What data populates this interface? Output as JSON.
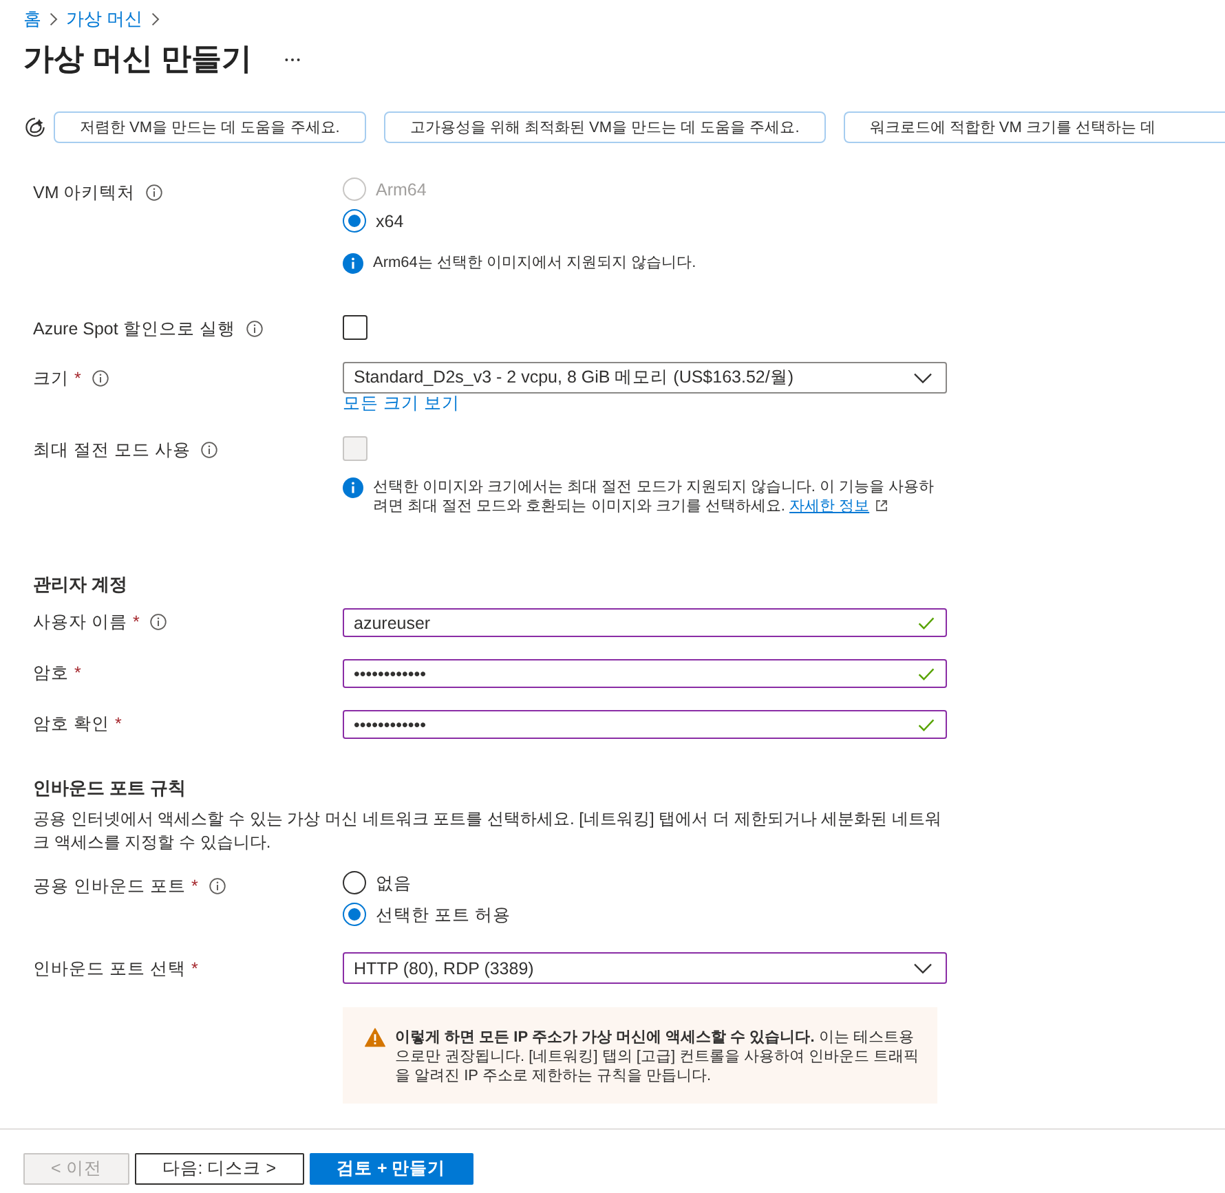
{
  "breadcrumb": [
    {
      "label": "홈"
    },
    {
      "label": "가상 머신"
    }
  ],
  "title": "가상 머신 만들기",
  "suggestions": [
    {
      "label": "저렴한 VM을 만드는 데 도움을 주세요."
    },
    {
      "label": "고가용성을 위해 최적화된 VM을 만드는 데 도움을 주세요."
    },
    {
      "label": "워크로드에 적합한 VM 크기를 선택하는 데"
    }
  ],
  "sections": [
    {
      "fields": [
        {
          "kind": "radio",
          "label": "VM 아키텍처",
          "info": true,
          "options": [
            {
              "label": "Arm64",
              "selected": false,
              "disabled": true
            },
            {
              "label": "x64",
              "selected": true,
              "disabled": false
            }
          ],
          "note": {
            "text": "Arm64는 선택한 이미지에서 지원되지 않습니다."
          }
        },
        {
          "kind": "checkbox",
          "label": "Azure Spot 할인으로 실행",
          "info": true,
          "checked": false,
          "disabled": false
        },
        {
          "kind": "dropdown",
          "label": "크기",
          "required_mark": "*",
          "info": true,
          "value": "Standard_D2s_v3 - 2 vcpu, 8 GiB 메모리 (US$163.52/월)",
          "edited": false,
          "link": "모든 크기 보기"
        },
        {
          "kind": "checkbox",
          "label": "최대 절전 모드 사용",
          "info": true,
          "checked": false,
          "disabled": true,
          "note": {
            "text": "선택한 이미지와 크기에서는 최대 절전 모드가 지원되지 않습니다. 이 기능을 사용하려면 최대 절전 모드와 호환되는 이미지와 크기를 선택하세요.",
            "link": "자세한 정보"
          }
        }
      ]
    },
    {
      "heading": "관리자 계정",
      "fields": [
        {
          "kind": "text",
          "label": "사용자 이름",
          "required_mark": "*",
          "info": true,
          "value": "azureuser",
          "edited": true,
          "valid": true
        },
        {
          "kind": "password",
          "label": "암호",
          "required_mark": "*",
          "value": "••••••••••••",
          "edited": true,
          "valid": true
        },
        {
          "kind": "password",
          "label": "암호 확인",
          "required_mark": "*",
          "value": "••••••••••••",
          "edited": true,
          "valid": true
        }
      ]
    },
    {
      "heading": "인바운드 포트 규칙",
      "description": "공용 인터넷에서 액세스할 수 있는 가상 머신 네트워크 포트를 선택하세요. [네트워킹] 탭에서 더 제한되거나 세분화된 네트워크 액세스를 지정할 수 있습니다.",
      "fields": [
        {
          "kind": "radio",
          "label": "공용 인바운드 포트",
          "required_mark": "*",
          "info": true,
          "options": [
            {
              "label": "없음",
              "selected": false,
              "disabled": false
            },
            {
              "label": "선택한 포트 허용",
              "selected": true,
              "disabled": false
            }
          ]
        },
        {
          "kind": "dropdown",
          "label": "인바운드 포트 선택",
          "required_mark": "*",
          "value": "HTTP (80), RDP (3389)",
          "edited": true,
          "warning": {
            "text": "**이렇게 하면 모든 IP 주소가 가상 머신에 액세스할 수 있습니다.** 이는 테스트용으로만 권장됩니다. [네트워킹] 탭의 [고급] 컨트롤을 사용하여 인바운드 트래픽을 알려진 IP 주소로 제한하는 규칙을 만듭니다."
          }
        }
      ]
    }
  ],
  "footer": [
    {
      "label": "< 이전",
      "kind": "secondary",
      "disabled": true
    },
    {
      "label": "다음: 디스크 >",
      "kind": "secondary",
      "disabled": false
    },
    {
      "label": "검토 + 만들기",
      "kind": "primary",
      "disabled": false
    }
  ]
}
